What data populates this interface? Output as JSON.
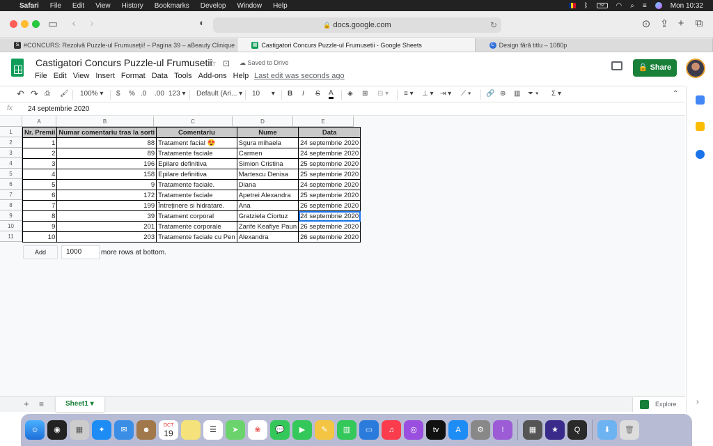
{
  "macos": {
    "menu_items": [
      "Safari",
      "File",
      "Edit",
      "View",
      "History",
      "Bookmarks",
      "Develop",
      "Window",
      "Help"
    ],
    "clock": "Mon 10:32",
    "battery": "52"
  },
  "safari": {
    "url": "docs.google.com",
    "tabs": [
      {
        "title": "#CONCURS: Rezolvă Puzzle-ul Frumuseții! – Pagina 39 – aBeauty Clinique"
      },
      {
        "title": "Castigatori Concurs Puzzle-ul Frumusetii - Google Sheets"
      },
      {
        "title": "Design fără titlu – 1080p"
      }
    ]
  },
  "doc": {
    "title": "Castigatori Concurs Puzzle-ul Frumusetii",
    "saved": "Saved to Drive",
    "last_edit": "Last edit was seconds ago",
    "menus": [
      "File",
      "Edit",
      "View",
      "Insert",
      "Format",
      "Data",
      "Tools",
      "Add-ons",
      "Help"
    ],
    "share": "Share"
  },
  "toolbar": {
    "zoom": "100%",
    "currency": "$",
    "percent": "%",
    "dec_less": ".0",
    "dec_more": ".00",
    "format": "123",
    "font": "Default (Ari...",
    "size": "10",
    "bold": "B",
    "italic": "I",
    "strike": "S",
    "color": "A",
    "sum": "Σ"
  },
  "formula": {
    "fx": "fx",
    "value": "24 septembrie 2020"
  },
  "columns": [
    "A",
    "B",
    "C",
    "D",
    "E"
  ],
  "rownums": [
    "1",
    "2",
    "3",
    "4",
    "5",
    "6",
    "7",
    "8",
    "9",
    "10",
    "11"
  ],
  "table": {
    "headers": [
      "Nr. Premii",
      "Numar comentariu tras la sorti",
      "Comentariu",
      "Nume",
      "Data"
    ],
    "rows": [
      [
        "1",
        "88",
        "Tratament facial 😍",
        "Sgura mihaela",
        "24 septembrie 2020"
      ],
      [
        "2",
        "89",
        "Tratamente faciale",
        "Carmen",
        "24 septembrie 2020"
      ],
      [
        "3",
        "196",
        "Epilare definitiva",
        "Simion Cristina",
        "25 septembrie 2020"
      ],
      [
        "4",
        "158",
        "Epilare definitiva",
        "Martescu Denisa",
        "25 septembrie 2020"
      ],
      [
        "5",
        "9",
        "Tratamente faciale.",
        "Diana",
        "24 septembrie 2020"
      ],
      [
        "6",
        "172",
        "Tratamente faciale",
        "Apetrei Alexandra",
        "25 septembrie 2020"
      ],
      [
        "7",
        "199",
        "Întreținere si hidratare.",
        "Ana",
        "26 septembrie 2020"
      ],
      [
        "8",
        "39",
        "Tratament corporal",
        "Gratziela Ciortuz",
        "24 septembrie 2020"
      ],
      [
        "9",
        "201",
        "Tratamente corporale",
        "Zarife Keafiye Paun",
        "26 septembrie 2020"
      ],
      [
        "10",
        "203",
        "Tratamente faciale cu Pen",
        "Alexandra",
        "26 septembrie 2020"
      ]
    ]
  },
  "addrows": {
    "button": "Add",
    "count": "1000",
    "text": "more rows at bottom."
  },
  "sheet": {
    "name": "Sheet1",
    "explore": "Explore"
  },
  "dock_month": "OCT",
  "dock_day": "19"
}
